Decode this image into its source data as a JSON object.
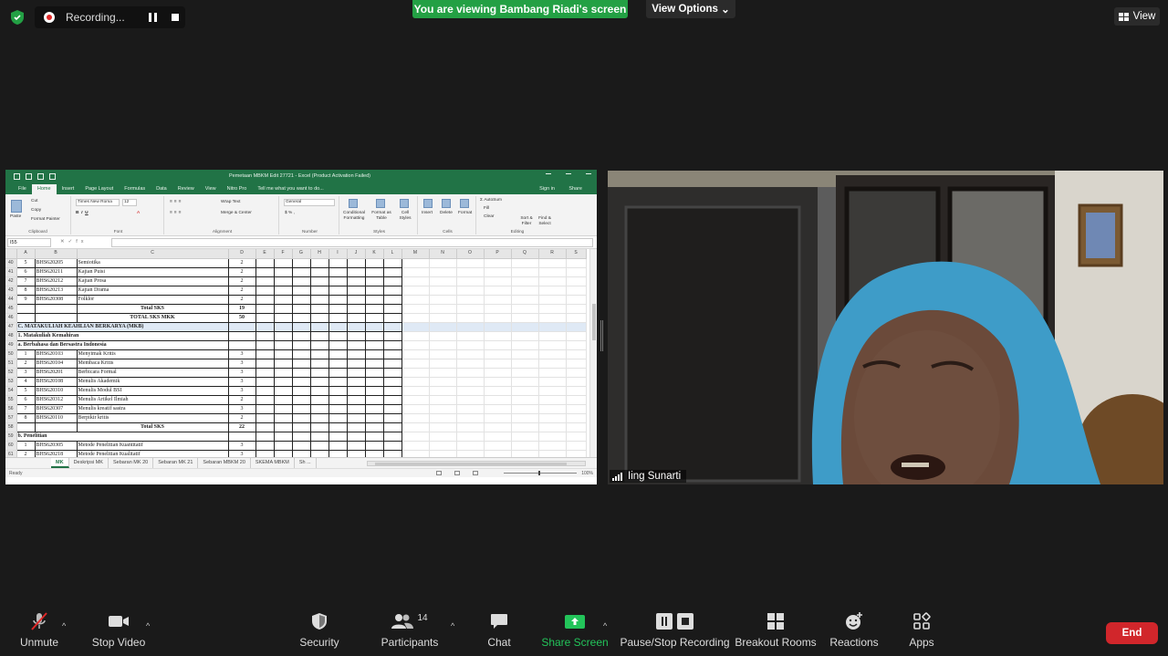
{
  "top": {
    "recording_label": "Recording...",
    "viewing_banner": "You are viewing Bambang Riadi's screen",
    "view_options": "View Options",
    "view_button": "View"
  },
  "excel": {
    "title": "Pemetaan MBKM Edit 27721 - Excel (Product Activation Failed)",
    "tabs": [
      "File",
      "Home",
      "Insert",
      "Page Layout",
      "Formulas",
      "Data",
      "Review",
      "View",
      "Nitro Pro"
    ],
    "tell_me": "Tell me what you want to do...",
    "sign_in": "Sign in",
    "share": "Share",
    "ribbon": {
      "paste": "Paste",
      "cut": "Cut",
      "copy": "Copy",
      "format_painter": "Format Painter",
      "font_name": "Times New Roma",
      "font_size": "12",
      "wrap_text": "Wrap Text",
      "merge_center": "Merge & Center",
      "number_format": "General",
      "conditional_formatting": "Conditional Formatting",
      "format_as_table": "Format as Table",
      "cell_styles": "Cell Styles",
      "insert": "Insert",
      "delete": "Delete",
      "format": "Format",
      "autosum": "AutoSum",
      "fill": "Fill",
      "clear": "Clear",
      "sort_filter": "Sort & Filter",
      "find_select": "Find & Select",
      "groups": [
        "Clipboard",
        "Font",
        "Alignment",
        "Number",
        "Styles",
        "Cells",
        "Editing"
      ]
    },
    "name_box": "I55",
    "columns": [
      "A",
      "B",
      "C",
      "D",
      "E",
      "F",
      "G",
      "H",
      "I",
      "J",
      "K",
      "L",
      "M",
      "N",
      "O",
      "P",
      "Q",
      "R",
      "S"
    ],
    "rows": [
      {
        "n": "40",
        "a": "5",
        "b": "BHS620205",
        "c": "Semiotika",
        "d": "2",
        "type": "item"
      },
      {
        "n": "41",
        "a": "6",
        "b": "BHS620211",
        "c": "Kajian Puisi",
        "d": "2",
        "type": "item"
      },
      {
        "n": "42",
        "a": "7",
        "b": "BHS620212",
        "c": "Kajian Prosa",
        "d": "2",
        "type": "item"
      },
      {
        "n": "43",
        "a": "8",
        "b": "BHS620213",
        "c": "Kajian Drama",
        "d": "2",
        "type": "item"
      },
      {
        "n": "44",
        "a": "9",
        "b": "BHS620308",
        "c": "Folklor",
        "d": "2",
        "type": "item"
      },
      {
        "n": "45",
        "a": "",
        "b": "",
        "c": "Total SKS",
        "d": "19",
        "type": "total"
      },
      {
        "n": "46",
        "a": "",
        "b": "",
        "c": "TOTAL SKS MKK",
        "d": "50",
        "type": "total"
      },
      {
        "n": "47",
        "a": "C. MATAKULIAH KEAHLIAN BERKARYA (MKB)",
        "b": "",
        "c": "",
        "d": "",
        "type": "section"
      },
      {
        "n": "48",
        "a": "1. Matakuliah Kemahiran",
        "b": "",
        "c": "",
        "d": "",
        "type": "heading"
      },
      {
        "n": "49",
        "a": "a. Berbahasa dan Bersastra Indonesia",
        "b": "",
        "c": "",
        "d": "",
        "type": "heading"
      },
      {
        "n": "50",
        "a": "1",
        "b": "BHS620103",
        "c": "Menyimak Kritis",
        "d": "3",
        "type": "item"
      },
      {
        "n": "51",
        "a": "2",
        "b": "BHS620104",
        "c": "Membaca Kritis",
        "d": "3",
        "type": "item"
      },
      {
        "n": "52",
        "a": "3",
        "b": "BHS620201",
        "c": "Berbicara Formal",
        "d": "3",
        "type": "item"
      },
      {
        "n": "53",
        "a": "4",
        "b": "BHS620108",
        "c": "Menulis Akademik",
        "d": "3",
        "type": "item"
      },
      {
        "n": "54",
        "a": "5",
        "b": "BHS620310",
        "c": "Menulis Modul BSI",
        "d": "3",
        "type": "item"
      },
      {
        "n": "55",
        "a": "6",
        "b": "BHS620312",
        "c": "Menulis Artikel Ilmiah",
        "d": "2",
        "type": "item"
      },
      {
        "n": "56",
        "a": "7",
        "b": "BHS620307",
        "c": "Menulis kreatif sastra",
        "d": "3",
        "type": "item"
      },
      {
        "n": "57",
        "a": "8",
        "b": "BHS620110",
        "c": "Berpikir kritis",
        "d": "2",
        "type": "item"
      },
      {
        "n": "58",
        "a": "",
        "b": "",
        "c": "Total SKS",
        "d": "22",
        "type": "total"
      },
      {
        "n": "59",
        "a": "b. Penelitian",
        "b": "",
        "c": "",
        "d": "",
        "type": "heading"
      },
      {
        "n": "60",
        "a": "1",
        "b": "BHS620305",
        "c": "Metode Penelitian Kuantitatif",
        "d": "3",
        "type": "item"
      },
      {
        "n": "61",
        "a": "2",
        "b": "BHS620218",
        "c": "Metode Penelitian Kualitatif",
        "d": "3",
        "type": "item"
      }
    ],
    "sheet_tabs": [
      "MK",
      "Deskripsi MK",
      "Sebaran MK 20",
      "Sebaran MK 21",
      "Sebaran MBKM 20",
      "SKEMA MBKM",
      "Sh ..."
    ],
    "status": "Ready",
    "zoom": "100%"
  },
  "video": {
    "participant_name": "Iing Sunarti"
  },
  "toolbar": {
    "unmute": "Unmute",
    "stop_video": "Stop Video",
    "security": "Security",
    "participants": "Participants",
    "participants_count": "14",
    "chat": "Chat",
    "share_screen": "Share Screen",
    "pause_stop_recording": "Pause/Stop Recording",
    "breakout_rooms": "Breakout Rooms",
    "reactions": "Reactions",
    "apps": "Apps",
    "end": "End"
  },
  "colors": {
    "banner_green": "#23a044",
    "excel_green": "#217346",
    "end_red": "#d1262b",
    "share_green": "#23c45a"
  }
}
